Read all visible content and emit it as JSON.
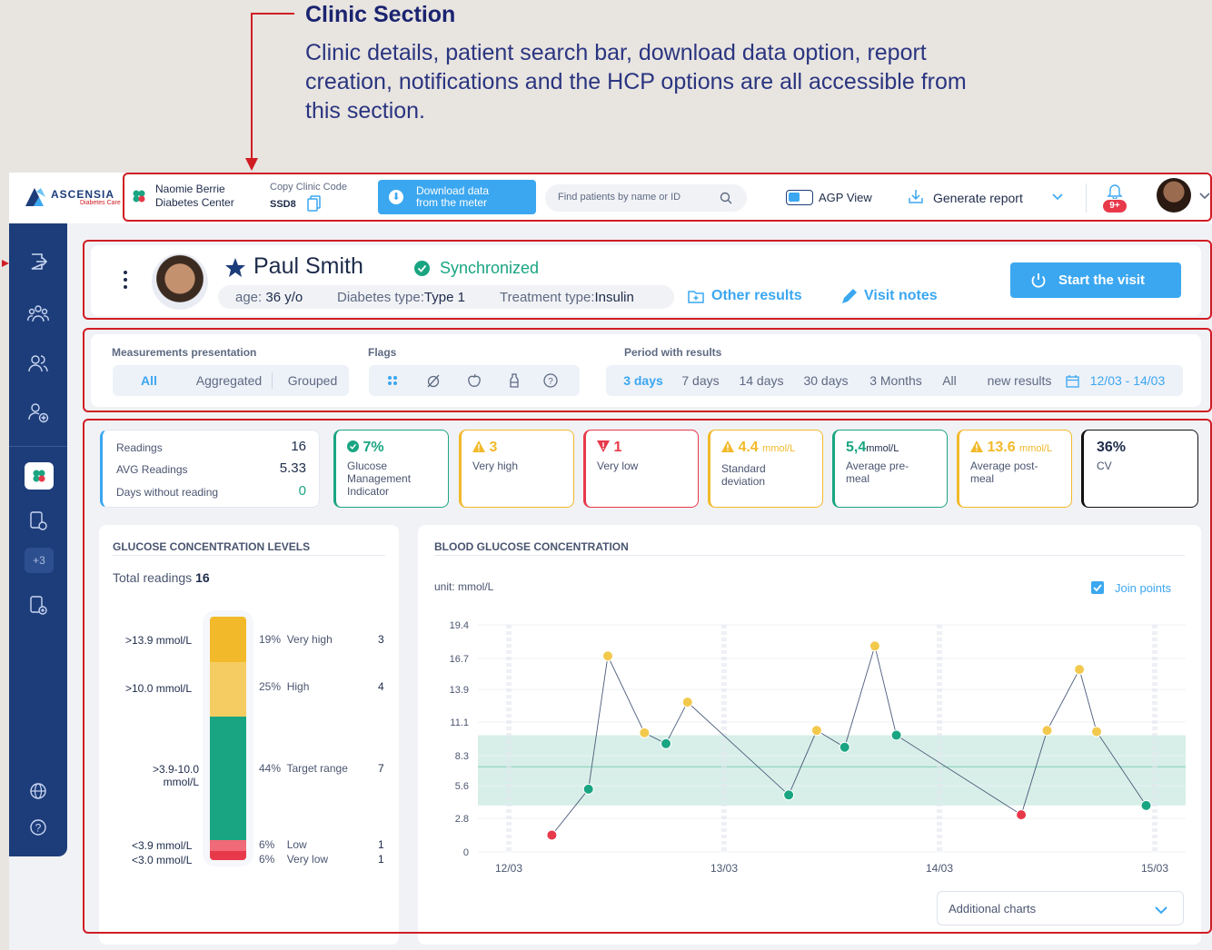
{
  "annotation": {
    "title": "Clinic Section",
    "description": "Clinic details, patient search bar, download data option, report creation, notifications and the HCP options are all accessible from this section."
  },
  "header": {
    "logo_text": "ASCENSIA",
    "logo_sub": "Diabetes Care",
    "clinic_name_line1": "Naomie Berrie",
    "clinic_name_line2": "Diabetes Center",
    "copy_code_label": "Copy Clinic Code",
    "clinic_code": "SSD8",
    "download_line1": "Download data",
    "download_line2": "from the meter",
    "search_placeholder": "Find patients by name or ID",
    "agp_label": "AGP View",
    "generate_report": "Generate report",
    "notif_badge": "9+"
  },
  "sidebar": {
    "badge": "+3"
  },
  "patient": {
    "name": "Paul Smith",
    "sync_status": "Synchronized",
    "age_label": "age:",
    "age_value": "36 y/o",
    "diabetes_label": "Diabetes type:",
    "diabetes_value": "Type 1",
    "treatment_label": "Treatment type:",
    "treatment_value": "Insulin",
    "other_results": "Other results",
    "visit_notes": "Visit notes",
    "start_visit": "Start the visit"
  },
  "filters": {
    "measurements_label": "Measurements presentation",
    "measurements": [
      "All",
      "Aggregated",
      "Grouped"
    ],
    "flags_label": "Flags",
    "period_label": "Period with results",
    "periods": [
      "3 days",
      "7 days",
      "14 days",
      "30 days",
      "3 Months",
      "All"
    ],
    "new_results": "new results",
    "date_range": "12/03 - 14/03"
  },
  "summary": {
    "readings_label": "Readings",
    "readings_value": "16",
    "avg_label": "AVG Readings",
    "avg_value": "5.33",
    "days_label": "Days without reading",
    "days_value": "0"
  },
  "kpis": [
    {
      "value": "7%",
      "unit": "",
      "label": "Glucose Management Indicator",
      "color": "#1aa582"
    },
    {
      "value": "3",
      "unit": "",
      "label": "Very high",
      "color": "#f2b92a"
    },
    {
      "value": "1",
      "unit": "",
      "label": "Very low",
      "color": "#e8394a"
    },
    {
      "value": "4.4",
      "unit": "mmol/L",
      "label": "Standard deviation",
      "color": "#f2b92a"
    },
    {
      "value": "5,4",
      "unit": "mmol/L",
      "label": "Average pre-meal",
      "color": "#1aa582"
    },
    {
      "value": "13.6",
      "unit": "mmol/L",
      "label": "Average post-meal",
      "color": "#f2b92a"
    },
    {
      "value": "36%",
      "unit": "",
      "label": "CV",
      "color": "#111111"
    }
  ],
  "glucose_levels": {
    "title": "GLUCOSE CONCENTRATION LEVELS",
    "total_label": "Total readings",
    "total_value": "16",
    "rows": [
      {
        "range": ">13.9 mmol/L",
        "pct": "19%",
        "label": "Very high",
        "count": "3",
        "color": "#f2b92a"
      },
      {
        "range": ">10.0 mmol/L",
        "pct": "25%",
        "label": "High",
        "count": "4",
        "color": "#f5cc61"
      },
      {
        "range": ">3.9-10.0 mmol/L",
        "pct": "44%",
        "label": "Target range",
        "count": "7",
        "color": "#1aa582"
      },
      {
        "range": "<3.9 mmol/L",
        "pct": "6%",
        "label": "Low",
        "count": "1",
        "color": "#f06a78"
      },
      {
        "range": "<3.0 mmol/L",
        "pct": "6%",
        "label": "Very low",
        "count": "1",
        "color": "#e8394a"
      }
    ]
  },
  "blood_chart": {
    "title": "BLOOD GLUCOSE CONCENTRATION",
    "unit": "unit: mmol/L",
    "join_points": "Join points",
    "additional_charts": "Additional charts"
  },
  "chart_data": {
    "type": "line",
    "title": "BLOOD GLUCOSE CONCENTRATION",
    "ylabel": "unit: mmol/L",
    "yticks": [
      "19.4",
      "16.7",
      "13.9",
      "11.1",
      "8.3",
      "5.6",
      "2.8",
      "0"
    ],
    "xticks": [
      "12/03",
      "13/03",
      "14/03",
      "15/03"
    ],
    "ylim": [
      0,
      19.4
    ],
    "xlim": [
      12.0,
      15.0
    ],
    "target_range": [
      3.9,
      10.0
    ],
    "target_line": 7.3,
    "series": [
      {
        "x": [
          12.2,
          12.37,
          12.46,
          12.63,
          12.73,
          12.83,
          13.3,
          13.43,
          13.56,
          13.7,
          13.8,
          14.38,
          14.5,
          14.65,
          14.73,
          14.96
        ],
        "y": [
          1.4,
          5.3,
          16.9,
          10.2,
          9.3,
          12.8,
          4.8,
          10.4,
          9.0,
          17.7,
          10.0,
          3.1,
          10.4,
          15.7,
          10.3,
          3.9
        ],
        "colors": [
          "#e8394a",
          "#1aa582",
          "#f2c94c",
          "#f2c94c",
          "#1aa582",
          "#f2c94c",
          "#1aa582",
          "#f2c94c",
          "#1aa582",
          "#f2c94c",
          "#1aa582",
          "#e8394a",
          "#f2c94c",
          "#f2c94c",
          "#f2c94c",
          "#1aa582"
        ]
      }
    ]
  }
}
